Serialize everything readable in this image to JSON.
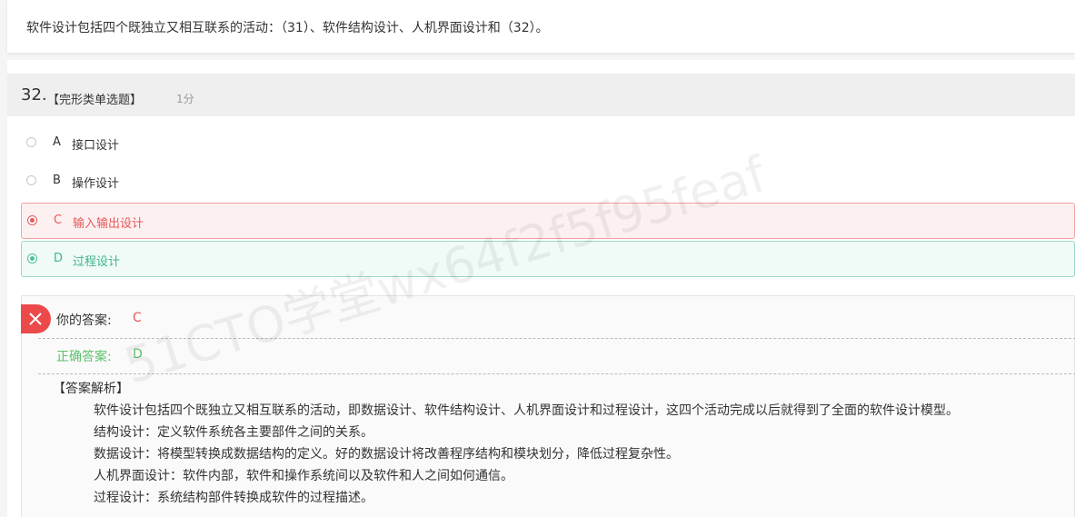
{
  "stem": {
    "text": "软件设计包括四个既独立又相互联系的活动：（31）、软件结构设计、人机界面设计和（32）。"
  },
  "question": {
    "number": "32.",
    "type": "【完形类单选题】",
    "score": "1分"
  },
  "options": [
    {
      "letter": "A",
      "text": "接口设计",
      "state": "none"
    },
    {
      "letter": "B",
      "text": "操作设计",
      "state": "none"
    },
    {
      "letter": "C",
      "text": "输入输出设计",
      "state": "wrong"
    },
    {
      "letter": "D",
      "text": "过程设计",
      "state": "correct"
    }
  ],
  "answer": {
    "your_label": "你的答案:",
    "your_value": "C",
    "correct_label": "正确答案:",
    "correct_value": "D",
    "analysis_title": "【答案解析】",
    "analysis_lines": [
      "软件设计包括四个既独立又相互联系的活动，即数据设计、软件结构设计、人机界面设计和过程设计，这四个活动完成以后就得到了全面的软件设计模型。",
      "结构设计：定义软件系统各主要部件之间的关系。",
      "数据设计：将模型转换成数据结构的定义。好的数据设计将改善程序结构和模块划分，降低过程复杂性。",
      "人机界面设计：软件内部，软件和操作系统间以及软件和人之间如何通信。",
      "过程设计：系统结构部件转换成软件的过程描述。"
    ]
  },
  "watermark": "51CTO学堂wx64f2f5f95feaf",
  "colors": {
    "wrong": "#e35a5a",
    "correct": "#3fb58f",
    "badge": "#ec4a4a"
  },
  "icons": {
    "wrong_badge": "close-icon"
  }
}
